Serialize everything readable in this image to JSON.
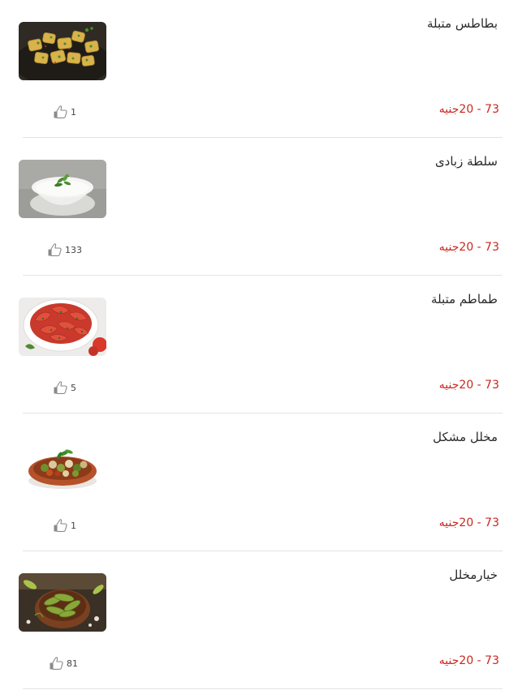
{
  "currency_label": "جنيه",
  "items": [
    {
      "name": "بطاطس متبلة",
      "price_range": "20 - 73",
      "likes": "1",
      "image_icon": "spiced-potatoes-photo"
    },
    {
      "name": "سلطة زبادى",
      "price_range": "20 - 73",
      "likes": "133",
      "image_icon": "yogurt-salad-photo"
    },
    {
      "name": "طماطم متبلة",
      "price_range": "20 - 73",
      "likes": "5",
      "image_icon": "spiced-tomatoes-photo"
    },
    {
      "name": "مخلل مشكل",
      "price_range": "20 - 73",
      "likes": "1",
      "image_icon": "mixed-pickles-photo"
    },
    {
      "name": "خيارمخلل",
      "price_range": "20 - 73",
      "likes": "81",
      "image_icon": "pickled-cucumber-photo"
    }
  ],
  "colors": {
    "price": "#c8281e",
    "divider": "#e4e4e4",
    "text": "#2a2a2a"
  }
}
